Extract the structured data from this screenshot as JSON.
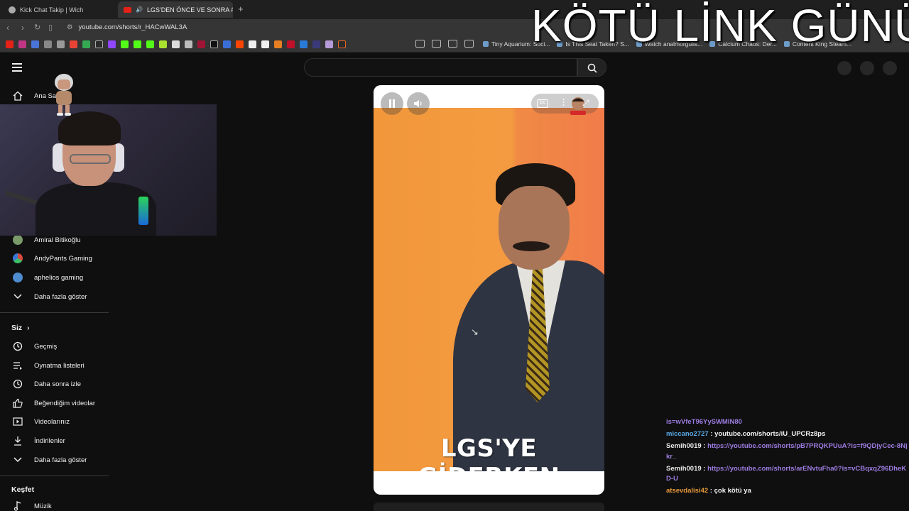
{
  "browser": {
    "tabs": [
      {
        "title": "Kick Chat Takip | Wich"
      },
      {
        "title": "LGS'DEN ÖNCE VE SONRA #s",
        "close": "×"
      }
    ],
    "new_tab": "+",
    "url": "youtube.com/shorts/r_HACwWAL3A",
    "bookmarks": [
      "Tiny Aquarium: Soci...",
      "Is This Seat Taken? S...",
      "Watch analmorgulis...",
      "Calcium Chaos: Der...",
      "Content King Steam..."
    ]
  },
  "overlay": {
    "title": "KÖTÜ LİNK GÜNÜ"
  },
  "sidebar": {
    "home_label": "Ana Sayfa",
    "subscriptions": [
      {
        "label": "Amiral Bitikoğlu",
        "color": "#7a9a6a"
      },
      {
        "label": "AndyPants Gaming",
        "color": "#d64b3c"
      },
      {
        "label": "aphelios gaming",
        "color": "#4e8ccf"
      }
    ],
    "show_more_1": "Daha fazla göster",
    "you_section": "Siz",
    "you_items": [
      {
        "label": "Geçmiş",
        "icon": "history-icon"
      },
      {
        "label": "Oynatma listeleri",
        "icon": "playlist-icon"
      },
      {
        "label": "Daha sonra izle",
        "icon": "clock-icon"
      },
      {
        "label": "Beğendiğim videolar",
        "icon": "like-icon"
      },
      {
        "label": "Videolarınız",
        "icon": "video-icon"
      },
      {
        "label": "İndirilenler",
        "icon": "download-icon"
      }
    ],
    "show_more_2": "Daha fazla göster",
    "explore_section": "Keşfet",
    "explore_items": [
      {
        "label": "Müzik",
        "icon": "music-icon"
      }
    ]
  },
  "player": {
    "caption": "LGS'YE GİDERKEN",
    "cc_label": "CC"
  },
  "chat": {
    "messages": [
      {
        "user": "",
        "text": "is=wVfeT96YySWMIN80",
        "is_link": true
      },
      {
        "user": "miccano2727",
        "color": "#5aa9e6",
        "text": "youtube.com/shorts/iU_UPCRz8ps",
        "is_link": false
      },
      {
        "user": "Semih0019",
        "color": "#e8e8e8",
        "text": "https://youtube.com/shorts/pB7PRQKPUuA?is=f9QDjyCec-8Njkr_",
        "is_link": true
      },
      {
        "user": "Semih0019",
        "color": "#e8e8e8",
        "text": "https://youtube.com/shorts/arENvtuFha0?is=vCBqxqZ96DheKD-U",
        "is_link": true
      },
      {
        "user": "atsevdalisi42",
        "color": "#e89a3a",
        "text": "çok kötü ya",
        "is_link": false
      }
    ]
  }
}
